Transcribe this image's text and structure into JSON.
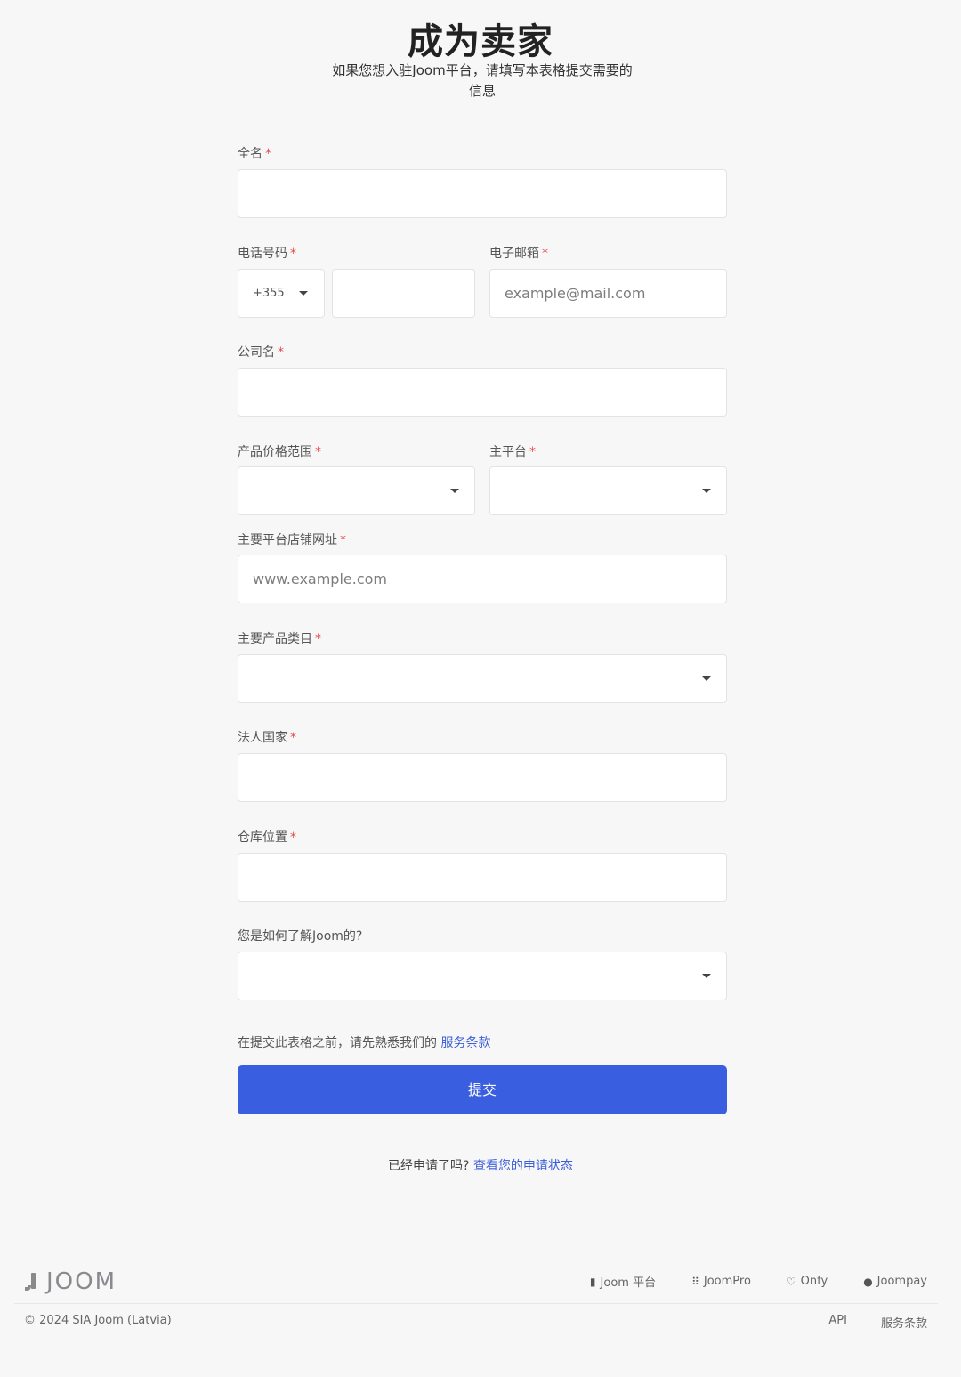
{
  "header": {
    "title": "成为卖家",
    "subtitle": "如果您想入驻Joom平台，请填写本表格提交需要的信息"
  },
  "form": {
    "required_mark": "*",
    "full_name": {
      "label": "全名",
      "value": ""
    },
    "phone": {
      "label": "电话号码",
      "country_code": "+355",
      "number": ""
    },
    "email": {
      "label": "电子邮箱",
      "placeholder": "example@mail.com"
    },
    "company": {
      "label": "公司名",
      "value": ""
    },
    "price_range": {
      "label": "产品价格范围",
      "value": ""
    },
    "main_platform": {
      "label": "主平台",
      "value": ""
    },
    "store_url": {
      "label": "主要平台店铺网址",
      "placeholder": "www.example.com"
    },
    "category": {
      "label": "主要产品类目",
      "value": ""
    },
    "legal_country": {
      "label": "法人国家",
      "value": ""
    },
    "warehouse": {
      "label": "仓库位置",
      "value": ""
    },
    "referral": {
      "label": "您是如何了解Joom的?",
      "value": ""
    },
    "terms_text": "在提交此表格之前，请先熟悉我们的",
    "terms_link": "服务条款",
    "submit_label": "提交",
    "status_text": "已经申请了吗?",
    "status_link": "查看您的申请状态"
  },
  "footer": {
    "logo_text": "JOOM",
    "links": [
      {
        "label": "Joom 平台",
        "icon": "joom-icon"
      },
      {
        "label": "JoomPro",
        "icon": "grid-dots-icon"
      },
      {
        "label": "Onfy",
        "icon": "heart-icon"
      },
      {
        "label": "Joompay",
        "icon": "joompay-icon"
      }
    ],
    "copyright": "© 2024 SIA Joom (Latvia)",
    "bottom_links": [
      "API",
      "服务条款"
    ]
  }
}
